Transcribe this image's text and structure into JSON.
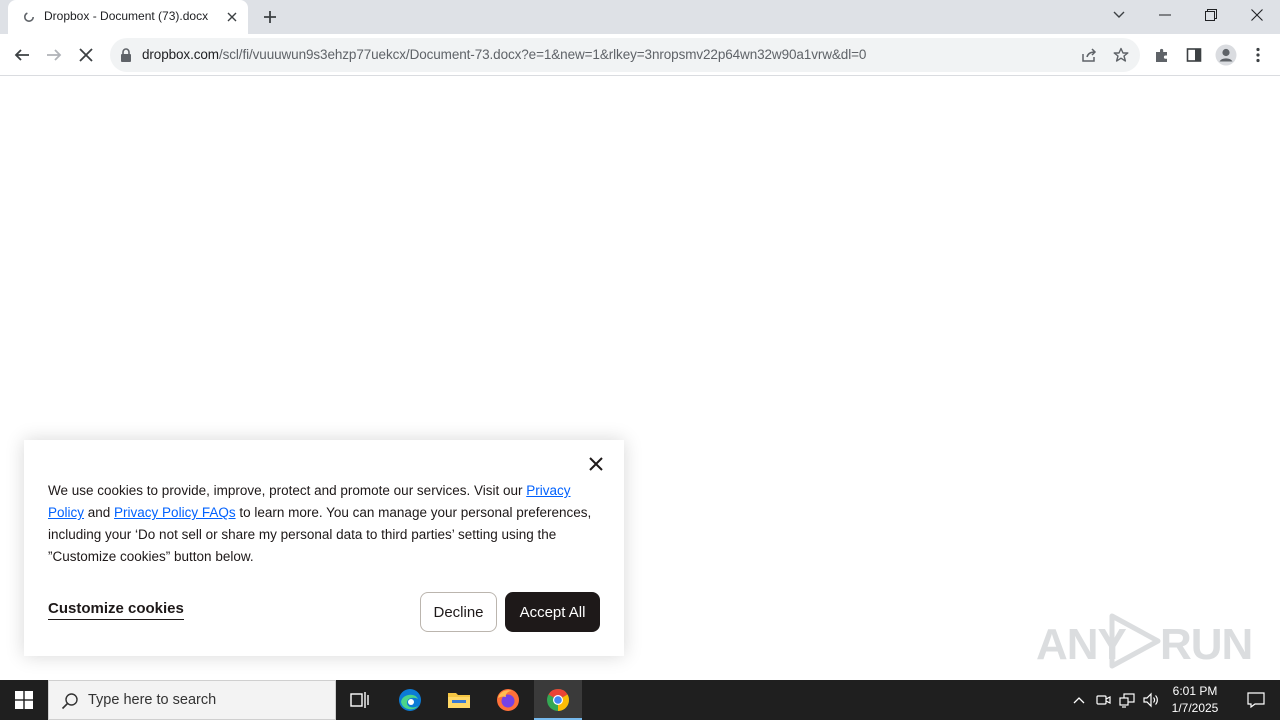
{
  "browser": {
    "tab": {
      "title": "Dropbox - Document (73).docx"
    },
    "address": {
      "host": "dropbox.com",
      "path": "/scl/fi/vuuuwun9s3ehzp77uekcx/Document-73.docx?e=1&new=1&rlkey=3nropsmv22p64wn32w90a1vrw&dl=0"
    }
  },
  "cookie_banner": {
    "text_1": "We use cookies to provide, improve, protect and promote our services. Visit our ",
    "link_privacy_policy": "Privacy Policy",
    "text_2": " and ",
    "link_privacy_faqs": "Privacy Policy FAQs",
    "text_3": " to learn more. You can manage your personal preferences, including your ‘Do not sell or share my personal data to third parties’ setting using the ”Customize cookies” button below.",
    "customize_label": "Customize cookies",
    "decline_label": "Decline",
    "accept_label": "Accept All"
  },
  "watermark": {
    "left": "ANY",
    "right": "RUN"
  },
  "taskbar": {
    "search_placeholder": "Type here to search",
    "time": "6:01 PM",
    "date": "1/7/2025"
  },
  "colors": {
    "tabstrip": "#dee1e6",
    "omnibox": "#f1f3f4",
    "link": "#0061fe",
    "accept_button": "#1e1919",
    "taskbar": "#1f1f1f"
  }
}
